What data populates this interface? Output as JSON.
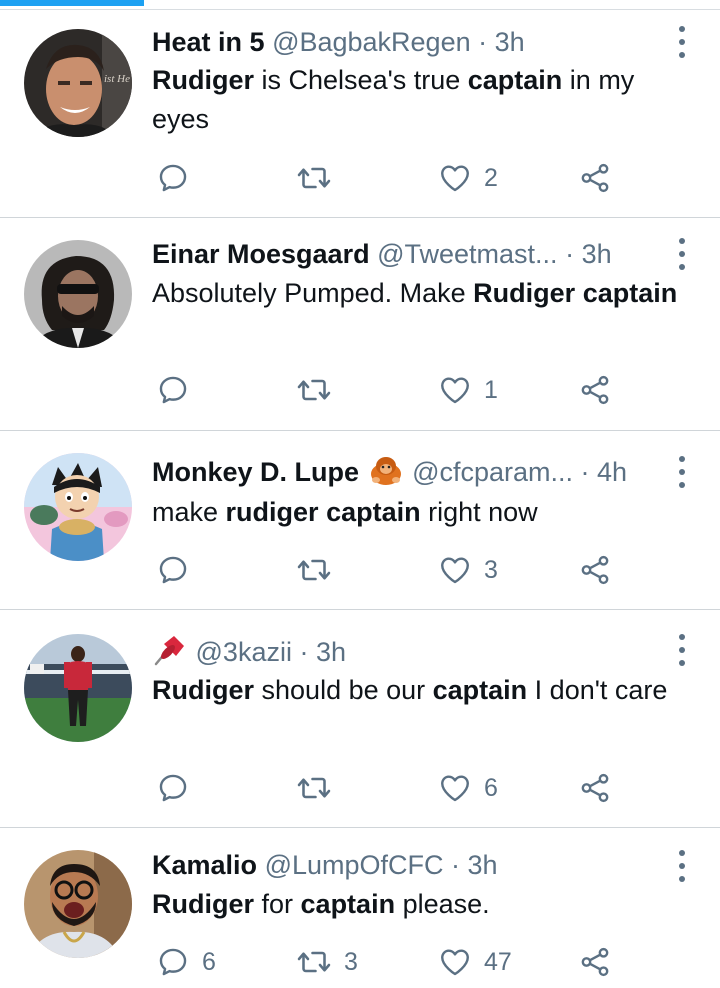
{
  "tweets": [
    {
      "name": "Heat in 5",
      "handle": "@BagbakRegen",
      "time": "3h",
      "text": [
        [
          "Rudiger",
          true
        ],
        [
          " is Chelsea's true ",
          false
        ],
        [
          "captain",
          true
        ],
        [
          " in my eyes",
          false
        ]
      ],
      "avatar_text": "ist He",
      "reply_count": "",
      "retweet_count": "",
      "like_count": "2"
    },
    {
      "name": "Einar Moesgaard",
      "handle": "@Tweetmast...",
      "time": "3h",
      "text": [
        [
          "Absolutely Pumped. Make ",
          false
        ],
        [
          "Rudiger",
          true
        ],
        [
          " ",
          false
        ],
        [
          "captain",
          true
        ]
      ],
      "reply_count": "",
      "retweet_count": "",
      "like_count": "1"
    },
    {
      "name": "Monkey D. Lupe",
      "handle": "@cfcparam...",
      "time": "4h",
      "text": [
        [
          "make ",
          false
        ],
        [
          "rudiger",
          true
        ],
        [
          " ",
          false
        ],
        [
          "captain",
          true
        ],
        [
          " right now",
          false
        ]
      ],
      "reply_count": "",
      "retweet_count": "",
      "like_count": "3"
    },
    {
      "name": "",
      "handle": "@3kazii",
      "time": "3h",
      "text": [
        [
          "Rudiger",
          true
        ],
        [
          " should be our ",
          false
        ],
        [
          "captain",
          true
        ],
        [
          " I don't care",
          false
        ]
      ],
      "reply_count": "",
      "retweet_count": "",
      "like_count": "6"
    },
    {
      "name": "Kamalio",
      "handle": "@LumpOfCFC",
      "time": "3h",
      "text": [
        [
          "Rudiger",
          true
        ],
        [
          " for ",
          false
        ],
        [
          "captain",
          true
        ],
        [
          " please.",
          false
        ]
      ],
      "reply_count": "6",
      "retweet_count": "3",
      "like_count": "47"
    }
  ],
  "icons": {
    "reply": "reply-icon",
    "retweet": "retweet-icon",
    "like": "heart-icon",
    "share": "share-icon",
    "more": "more-vertical-icon",
    "name_emoji_3": "orangutan-emoji",
    "name_emoji_4": "pushpin-emoji"
  },
  "colors": {
    "accent": "#1da1f2",
    "text": "#0f1419",
    "secondary": "#5b7083",
    "divider": "#d0d5d9"
  }
}
